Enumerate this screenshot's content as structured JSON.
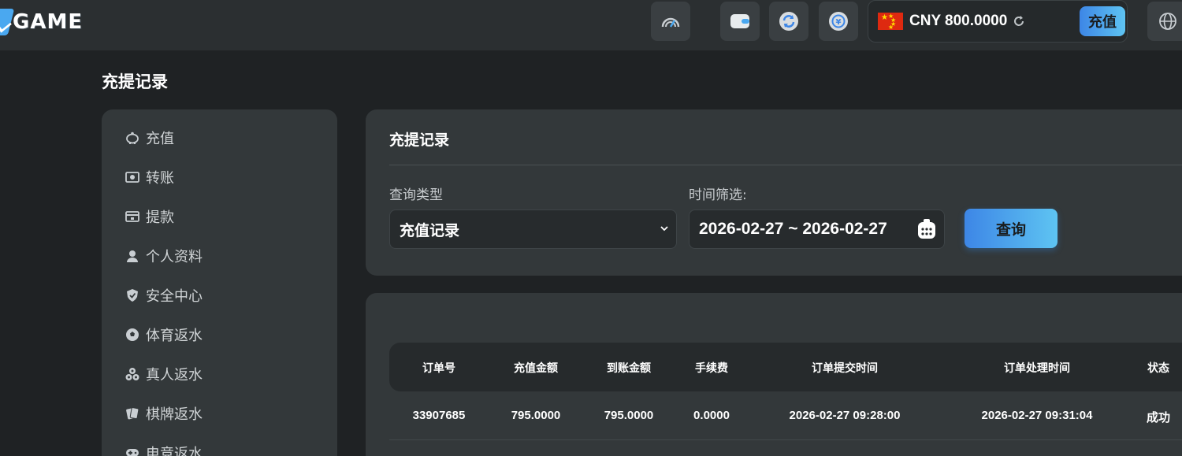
{
  "brand": {
    "logo_text": "GAME"
  },
  "header": {
    "balance": "CNY 800.0000",
    "recharge_label": "充值"
  },
  "page": {
    "title": "充提记录"
  },
  "sidebar": {
    "items": [
      {
        "label": "充值",
        "icon": "piggy-bank-icon"
      },
      {
        "label": "转账",
        "icon": "money-transfer-icon"
      },
      {
        "label": "提款",
        "icon": "withdraw-icon"
      },
      {
        "label": "个人资料",
        "icon": "user-icon"
      },
      {
        "label": "安全中心",
        "icon": "shield-icon"
      },
      {
        "label": "体育返水",
        "icon": "soccer-ball-icon"
      },
      {
        "label": "真人返水",
        "icon": "casino-chips-icon"
      },
      {
        "label": "棋牌返水",
        "icon": "playing-cards-icon"
      },
      {
        "label": "电竞返水",
        "icon": "gamepad-icon"
      }
    ]
  },
  "filter": {
    "title": "充提记录",
    "type_label": "查询类型",
    "type_value": "充值记录",
    "time_label": "时间筛选:",
    "date_range": "2026-02-27 ~ 2026-02-27",
    "query_label": "查询"
  },
  "table": {
    "columns": [
      "订单号",
      "充值金额",
      "到账金额",
      "手续费",
      "订单提交时间",
      "订单处理时间",
      "状态"
    ],
    "rows": [
      [
        "33907685",
        "795.0000",
        "795.0000",
        "0.0000",
        "2026-02-27 09:28:00",
        "2026-02-27 09:31:04",
        "成功"
      ]
    ]
  },
  "colors": {
    "background": "#1f2224",
    "card": "#33383a",
    "accent_start": "#3d86e6",
    "accent_end": "#5ec4f2"
  }
}
